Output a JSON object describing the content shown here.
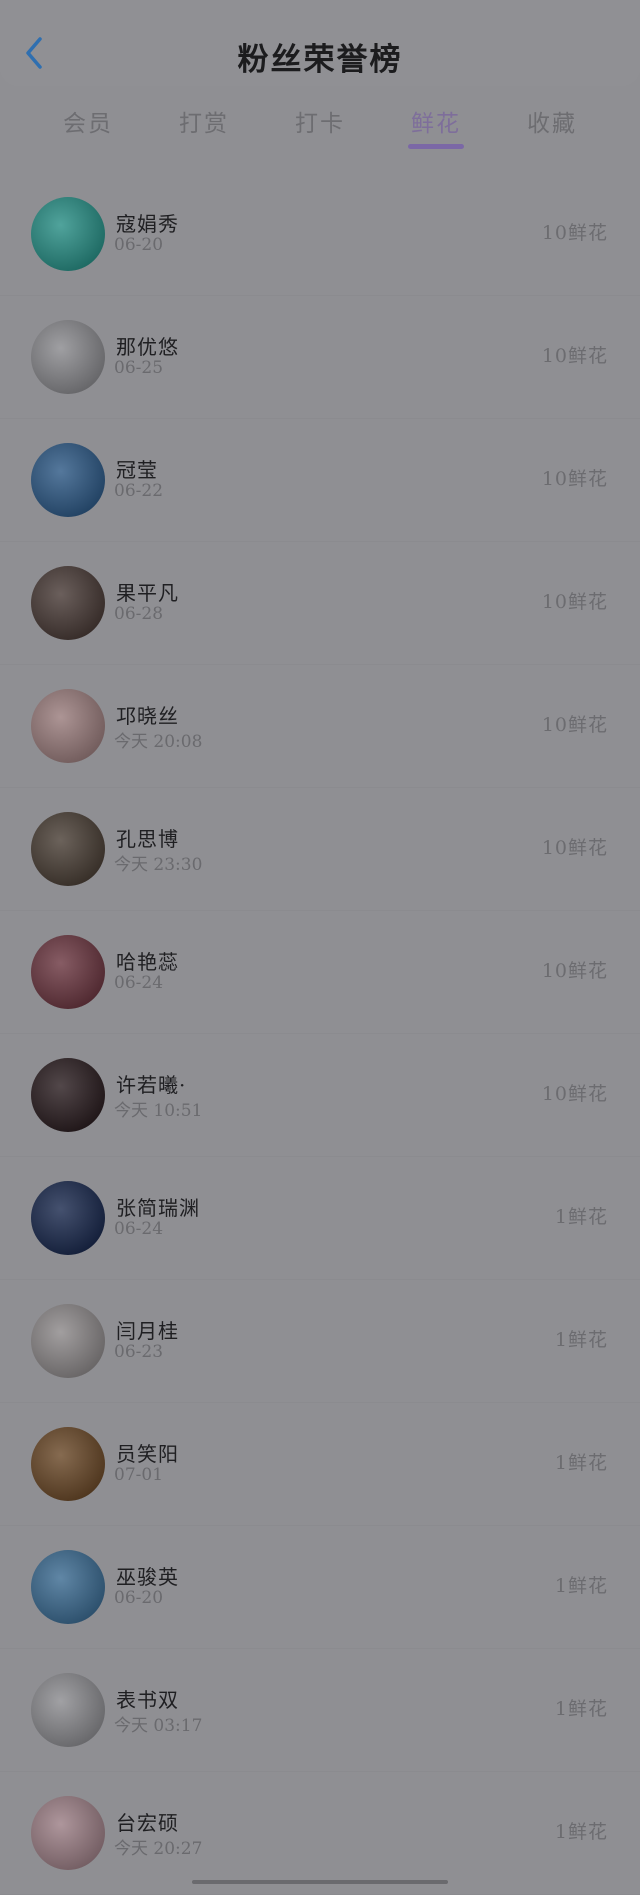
{
  "header": {
    "title": "粉丝荣誉榜"
  },
  "tabs": [
    {
      "label": "会员"
    },
    {
      "label": "打赏"
    },
    {
      "label": "打卡"
    },
    {
      "label": "鲜花"
    },
    {
      "label": "收藏"
    }
  ],
  "active_tab": 3,
  "colors": {
    "background": "#8f8f93",
    "accent": "#7b68a6"
  },
  "rows": [
    {
      "name": "寇娟秀",
      "date": "06-20",
      "count": "10鲜花",
      "avatar_icon": "child-photo-icon",
      "avatar_color": "#2a8f86"
    },
    {
      "name": "那优悠",
      "date": "06-25",
      "count": "10鲜花",
      "avatar_icon": "cartoon-emperor-icon",
      "avatar_color": "#8a8a8e"
    },
    {
      "name": "冠莹",
      "date": "06-22",
      "count": "10鲜花",
      "avatar_icon": "anime-girl-icon",
      "avatar_color": "#2f5a86"
    },
    {
      "name": "果平凡",
      "date": "06-28",
      "count": "10鲜花",
      "avatar_icon": "portrait-photo-icon",
      "avatar_color": "#4a3c38"
    },
    {
      "name": "邛晓丝",
      "date": "今天 20:08",
      "count": "10鲜花",
      "avatar_icon": "red-pig-icon",
      "avatar_color": "#9a7d7d"
    },
    {
      "name": "孔思博",
      "date": "今天 23:30",
      "count": "10鲜花",
      "avatar_icon": "portrait-photo-icon",
      "avatar_color": "#4b4037"
    },
    {
      "name": "哈艳蕊",
      "date": "06-24",
      "count": "10鲜花",
      "avatar_icon": "portrait-photo-icon",
      "avatar_color": "#6c3842"
    },
    {
      "name": "许若曦·",
      "date": "今天 10:51",
      "count": "10鲜花",
      "avatar_icon": "dark-photo-icon",
      "avatar_color": "#2c1f22"
    },
    {
      "name": "张简瑞渊",
      "date": "06-24",
      "count": "1鲜花",
      "avatar_icon": "neon-sign-icon",
      "avatar_color": "#1c2b4f"
    },
    {
      "name": "闫月桂",
      "date": "06-23",
      "count": "1鲜花",
      "avatar_icon": "flower-icon",
      "avatar_color": "#8d898a"
    },
    {
      "name": "员笑阳",
      "date": "07-01",
      "count": "1鲜花",
      "avatar_icon": "sunset-photo-icon",
      "avatar_color": "#6b4a2a"
    },
    {
      "name": "巫骏英",
      "date": "06-20",
      "count": "1鲜花",
      "avatar_icon": "lake-landscape-icon",
      "avatar_color": "#3d6c92"
    },
    {
      "name": "表书双",
      "date": "今天 03:17",
      "count": "1鲜花",
      "avatar_icon": "ink-sketch-icon",
      "avatar_color": "#8c8c90"
    },
    {
      "name": "台宏硕",
      "date": "今天 20:27",
      "count": "1鲜花",
      "avatar_icon": "pink-cartoon-icon",
      "avatar_color": "#9c7f86"
    }
  ]
}
